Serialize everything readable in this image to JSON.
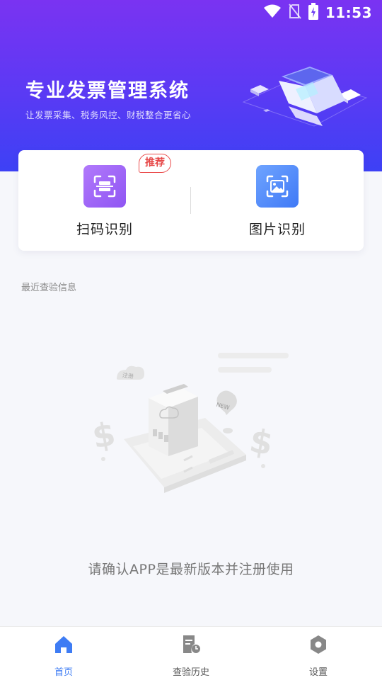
{
  "status_bar": {
    "time": "11:53"
  },
  "hero": {
    "title": "专业发票管理系统",
    "subtitle": "让发票采集、税务风控、财税整合更省心"
  },
  "actions": [
    {
      "label": "扫码识别",
      "icon": "scan-icon",
      "badge": "推荐"
    },
    {
      "label": "图片识别",
      "icon": "image-icon"
    }
  ],
  "recent": {
    "title": "最近查验信息",
    "empty_text": "请确认APP是最新版本并注册使用",
    "illustration_labels": {
      "cloud": "注册",
      "bubble": "NEW"
    }
  },
  "tabbar": {
    "items": [
      {
        "label": "首页",
        "icon": "home-icon",
        "active": true
      },
      {
        "label": "查验历史",
        "icon": "history-icon",
        "active": false
      },
      {
        "label": "设置",
        "icon": "settings-icon",
        "active": false
      }
    ]
  },
  "colors": {
    "hero_gradient_top": "#7a33f2",
    "hero_gradient_bottom": "#3d41f5",
    "scan_icon_bg": "#9a60f6",
    "image_icon_bg": "#4f86f7",
    "badge_red": "#e64545",
    "tab_active": "#3e7cf4"
  }
}
